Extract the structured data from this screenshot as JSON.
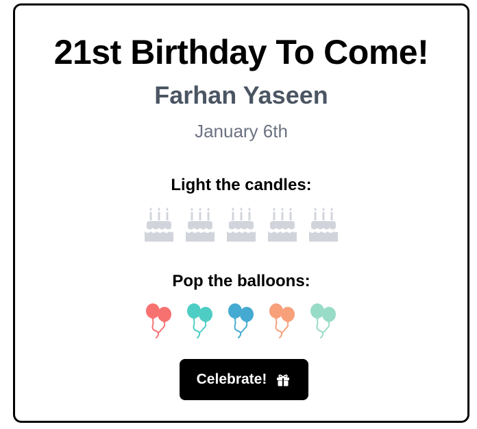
{
  "card": {
    "title": "21st Birthday To Come!",
    "name": "Farhan Yaseen",
    "date": "January 6th"
  },
  "candles": {
    "label": "Light the candles:",
    "count": 5,
    "lit": 0,
    "icon": "birthday-cake-icon",
    "unlit_color": "#d1d5db"
  },
  "balloons": {
    "label": "Pop the balloons:",
    "icon": "balloons-icon",
    "colors": [
      "#f87171",
      "#4ecdc4",
      "#45aad1",
      "#f8a07a",
      "#98dbc6"
    ]
  },
  "button": {
    "label": "Celebrate!",
    "icon": "gift-icon",
    "background": "#000000",
    "text_color": "#ffffff"
  }
}
